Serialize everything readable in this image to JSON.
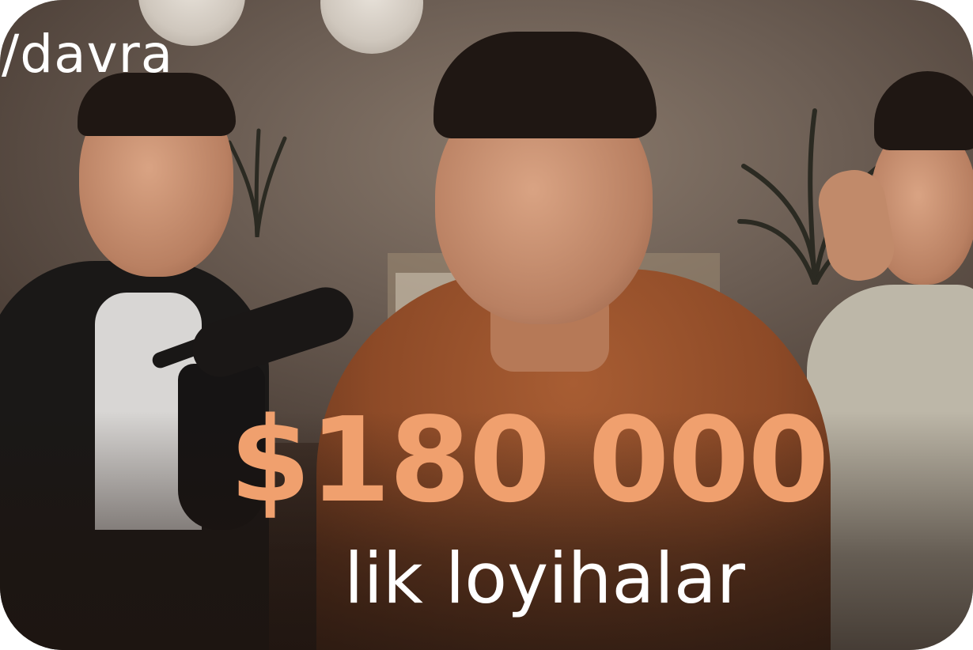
{
  "thumbnail": {
    "logo_text": "/davra",
    "headline": "$180 000",
    "subline": "lik loyihalar",
    "headline_color": "#f0a06e",
    "subline_color": "#ffffff"
  },
  "scene": {
    "people_count": 3,
    "objects": [
      "microphone",
      "plant",
      "ceiling-lamp"
    ]
  }
}
